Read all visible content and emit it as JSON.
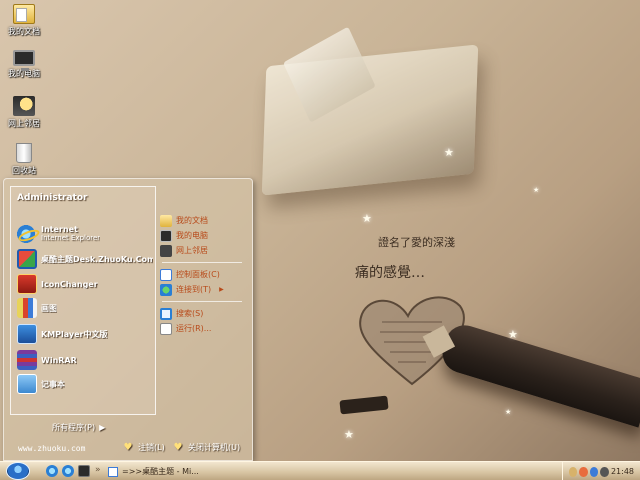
{
  "desktop": {
    "icons": [
      {
        "label": "我的文档",
        "icon": "my-documents-icon"
      },
      {
        "label": "我的电脑",
        "icon": "my-computer-icon"
      },
      {
        "label": "网上邻居",
        "icon": "network-places-icon"
      },
      {
        "label": "回收站",
        "icon": "recycle-bin-icon"
      }
    ],
    "wallpaper_text": {
      "line1": "證名了愛的深淺",
      "line2": "痛的感覺…"
    }
  },
  "start_menu": {
    "user": "Administrator",
    "left_items": [
      {
        "title": "Internet",
        "subtitle": "Internet Explorer",
        "icon": "internet-explorer-icon"
      },
      {
        "title": "桌酷主题Desk.ZhuoKu.Com",
        "subtitle": "",
        "icon": "theme-icon"
      },
      {
        "title": "IconChanger",
        "subtitle": "",
        "icon": "iconchanger-icon"
      },
      {
        "title": "画图",
        "subtitle": "",
        "icon": "paint-icon"
      },
      {
        "title": "KMPlayer中文版",
        "subtitle": "",
        "icon": "kmplayer-icon"
      },
      {
        "title": "WinRAR",
        "subtitle": "",
        "icon": "winrar-icon"
      },
      {
        "title": "记事本",
        "subtitle": "",
        "icon": "notepad-icon"
      }
    ],
    "all_programs": "所有程序(P)",
    "right_items": [
      {
        "label": "我的文档",
        "icon": "my-documents-icon"
      },
      {
        "label": "我的电脑",
        "icon": "my-computer-icon"
      },
      {
        "label": "网上邻居",
        "icon": "network-places-icon"
      },
      {
        "label": "控制面板(C)",
        "icon": "control-panel-icon"
      },
      {
        "label": "连接到(T)",
        "icon": "connect-to-icon"
      },
      {
        "label": "搜索(S)",
        "icon": "search-icon"
      },
      {
        "label": "运行(R)...",
        "icon": "run-icon"
      }
    ],
    "url": "www.zhuoku.com",
    "logoff": "注销(L)",
    "shutdown": "关闭计算机(U)"
  },
  "taskbar": {
    "task_label": "=>>桌酷主题 - Mi...",
    "clock": "21:48"
  },
  "colors": {
    "accent": "#b84a1a",
    "taskbar": "#d6c3a1"
  }
}
